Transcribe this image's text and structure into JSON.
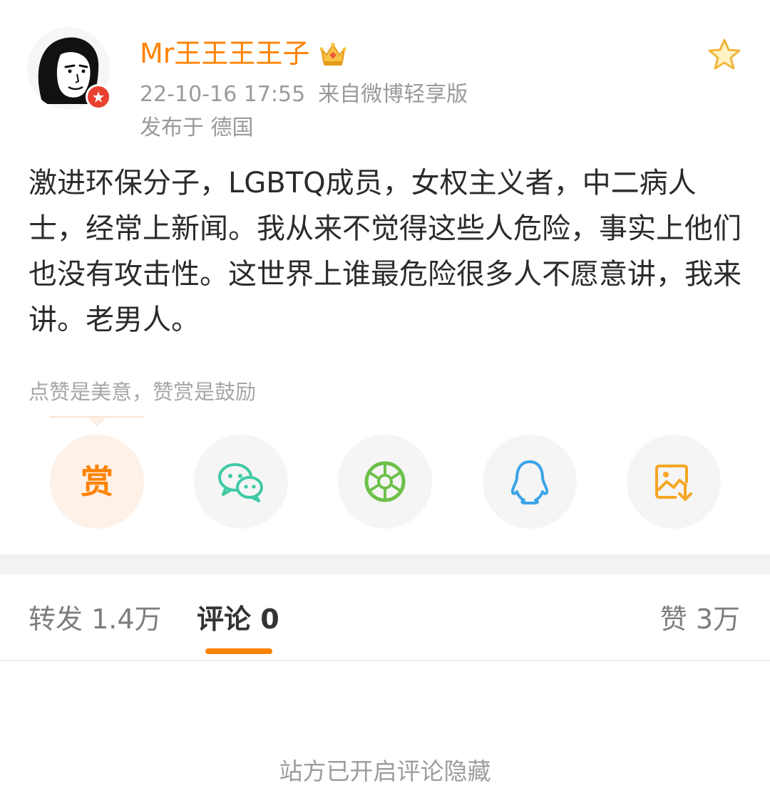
{
  "post": {
    "author": {
      "name": "Mr王王王王子",
      "avatar_icon": "cartoon-portrait-avatar",
      "badge_icon": "vip-badge-icon",
      "crown_icon": "crown-icon"
    },
    "timestamp": "22-10-16 17:55",
    "source": "来自微博轻享版",
    "location": "发布于 德国",
    "content": "激进环保分子，LGBTQ成员，女权主义者，中二病人士，经常上新闻。我从来不觉得这些人危险，事实上他们也没有攻击性。这世界上谁最危险很多人不愿意讲，我来讲。老男人。",
    "favorite_icon": "star-outline-icon"
  },
  "reward": {
    "hint": "点赞是美意，赞赏是鼓励",
    "button_label": "赏"
  },
  "share_buttons": [
    {
      "name": "reward",
      "icon": "reward-icon",
      "color": "#ff8200"
    },
    {
      "name": "wechat",
      "icon": "wechat-icon",
      "color": "#3fc9a5"
    },
    {
      "name": "moments",
      "icon": "wechat-moments-icon",
      "color": "#6cc04a"
    },
    {
      "name": "qq",
      "icon": "qq-penguin-icon",
      "color": "#3aa4e8"
    },
    {
      "name": "save-image",
      "icon": "save-image-icon",
      "color": "#f6a623"
    }
  ],
  "tabs": {
    "repost": "转发 1.4万",
    "comments": "评论 0",
    "likes": "赞 3万"
  },
  "comments": {
    "hidden_notice": "站方已开启评论隐藏"
  },
  "colors": {
    "accent": "#ff8200",
    "text": "#2b2b2b",
    "muted": "#9a9a9a",
    "divider": "#f2f2f2"
  }
}
